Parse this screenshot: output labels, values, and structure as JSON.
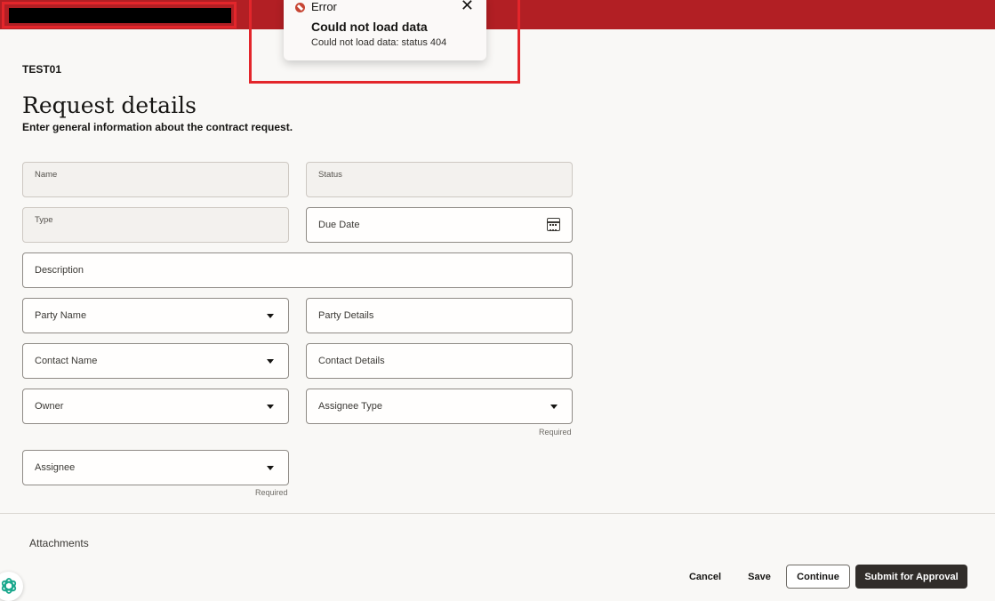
{
  "error_toast": {
    "label": "Error",
    "headline": "Could not load data",
    "detail": "Could not load data: status 404",
    "close_glyph": "✕"
  },
  "record_id": "TEST01",
  "page": {
    "title": "Request details",
    "subtitle": "Enter general information about the contract request."
  },
  "fields": {
    "name": "Name",
    "status": "Status",
    "type": "Type",
    "due_date": "Due Date",
    "description": "Description",
    "party_name": "Party Name",
    "party_details": "Party Details",
    "contact_name": "Contact Name",
    "contact_details": "Contact Details",
    "owner": "Owner",
    "assignee_type": "Assignee Type",
    "assignee": "Assignee",
    "required_hint": "Required"
  },
  "section_peek": "Attachments",
  "footer": {
    "cancel": "Cancel",
    "save": "Save",
    "continue": "Continue",
    "submit": "Submit for Approval"
  },
  "colors": {
    "brand_bar": "#b21f24",
    "error": "#c74634",
    "annotation": "#e3262b",
    "primary_button": "#312d2a"
  },
  "icons": [
    "error-icon",
    "close-icon",
    "calendar-icon",
    "chevron-down-icon",
    "assistant-icon"
  ]
}
